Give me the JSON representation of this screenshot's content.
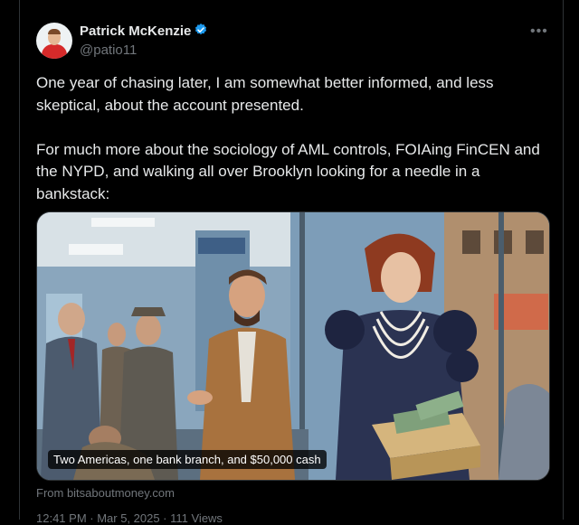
{
  "author": {
    "name": "Patrick McKenzie",
    "handle": "@patio11",
    "verified": true
  },
  "menu": {
    "more_label": "•••"
  },
  "tweet": {
    "text": "One year of chasing later, I am somewhat better informed, and less skeptical, about the account presented.\n\nFor much more about the sociology of AML controls, FOIAing FinCEN and the NYPD, and walking all over Brooklyn looking for a needle in a bankstack:"
  },
  "media": {
    "caption": "Two Americas, one bank branch, and $50,000 cash",
    "source": "From bitsaboutmoney.com"
  },
  "meta": {
    "timestamp": "12:41 PM · Mar 5, 2025 · 111 Views"
  },
  "colors": {
    "background": "#000000",
    "text": "#e7e9ea",
    "muted": "#71767b",
    "verified": "#1d9bf0"
  }
}
